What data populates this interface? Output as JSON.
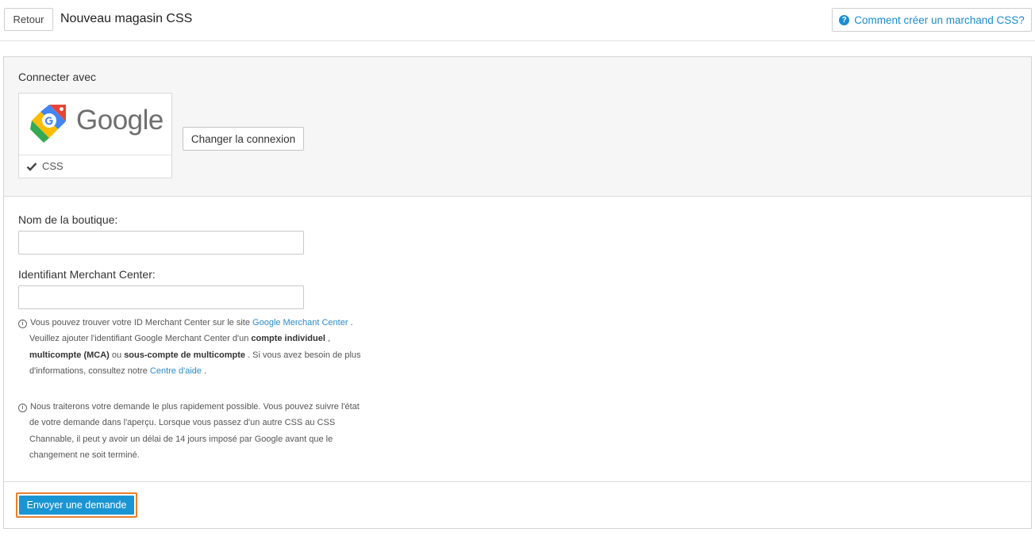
{
  "header": {
    "back_label": "Retour",
    "title": "Nouveau magasin CSS",
    "help_label": "Comment créer un marchand CSS?",
    "help_icon": "?"
  },
  "connect": {
    "label": "Connecter avec",
    "provider": {
      "logo_text": "Google",
      "status_label": "CSS"
    },
    "change_label": "Changer la connexion"
  },
  "form": {
    "shop_name": {
      "label": "Nom de la boutique:",
      "value": "",
      "placeholder": ""
    },
    "merchant_id": {
      "label": "Identifiant Merchant Center:",
      "value": "",
      "placeholder": ""
    },
    "info_note": {
      "t1": "Vous pouvez trouver votre ID Merchant Center sur le site ",
      "link1": "Google Merchant Center",
      "t2": " .",
      "t3": "Veuillez ajouter l'identifiant Google Merchant Center d'un ",
      "b1": "compte individuel",
      "t4": " ,",
      "b2": "multicompte (MCA)",
      "t5": " ou ",
      "b3": "sous-compte de multicompte",
      "t6": " . Si vous avez besoin de plus",
      "t7": "d'informations, consultez notre ",
      "link2": "Centre d'aide",
      "t8": " ."
    },
    "process_note": {
      "l1": "Nous traiterons votre demande le plus rapidement possible. Vous pouvez suivre l'état",
      "l2": "de votre demande dans l'aperçu. Lorsque vous passez d'un autre CSS au CSS",
      "l3": "Channable, il peut y avoir un délai de 14 jours imposé par Google avant que le",
      "l4": "changement ne soit terminé."
    }
  },
  "footer": {
    "submit_label": "Envoyer une demande"
  },
  "colors": {
    "accent": "#1a95d3",
    "link": "#2a8bc7",
    "focus_outline": "#e8802e",
    "panel_bg": "#f6f6f6"
  },
  "icons": [
    "question-circle-icon",
    "google-tag-logo-icon",
    "checkmark-icon",
    "info-circle-icon"
  ]
}
